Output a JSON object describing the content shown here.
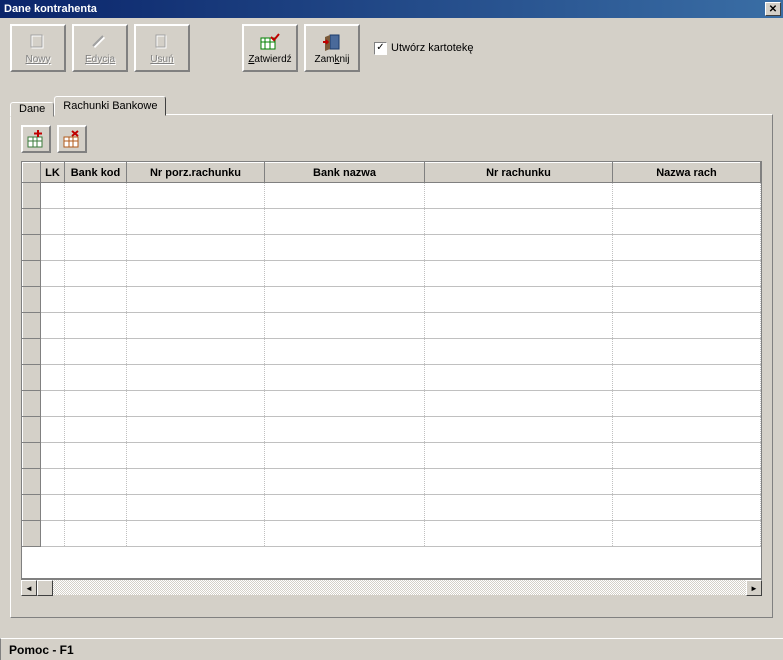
{
  "window": {
    "title": "Dane kontrahenta"
  },
  "toolbar": {
    "nowy_label": "Nowy",
    "edycja_label": "Edycja",
    "usun_label": "Usuń",
    "zatwierdz_label": "Zatwierdź",
    "zamknij_label": "Zamknij"
  },
  "checkbox": {
    "utworz_label": "Utwórz kartotekę",
    "checked": true
  },
  "tabs": {
    "dane_label": "Dane",
    "rachunki_label": "Rachunki Bankowe"
  },
  "grid": {
    "headers": {
      "lk": "LK",
      "bank_kod": "Bank kod",
      "nr_porz": "Nr porz.rachunku",
      "bank_nazwa": "Bank nazwa",
      "nr_rachunku": "Nr rachunku",
      "nazwa_rach": "Nazwa rach"
    },
    "rows": []
  },
  "status": {
    "help": "Pomoc - F1"
  }
}
